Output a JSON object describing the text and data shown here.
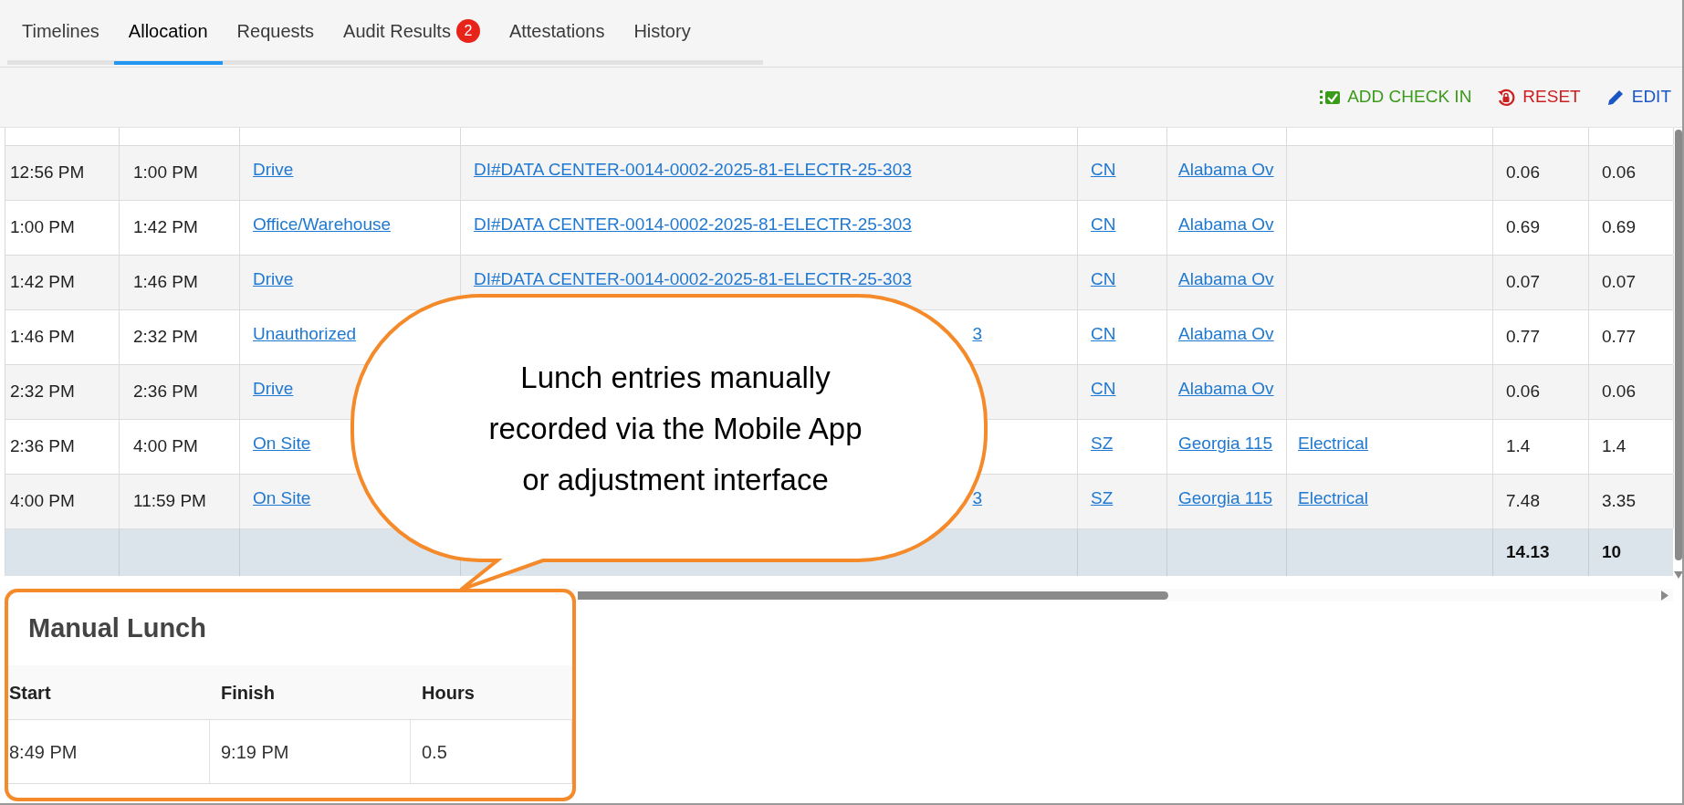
{
  "tabs": [
    {
      "label": "Timelines",
      "selected": false
    },
    {
      "label": "Allocation",
      "selected": true
    },
    {
      "label": "Requests",
      "selected": false
    },
    {
      "label": "Audit Results",
      "selected": false,
      "badge": "2"
    },
    {
      "label": "Attestations",
      "selected": false
    },
    {
      "label": "History",
      "selected": false
    }
  ],
  "toolbar": {
    "actions": [
      {
        "label": "ADD CHECK IN",
        "kind": "add"
      },
      {
        "label": "RESET",
        "kind": "reset"
      },
      {
        "label": "EDIT",
        "kind": "edit"
      }
    ]
  },
  "table": {
    "rows": [
      {
        "start": "12:56 PM",
        "finish": "1:00 PM",
        "activity": "Drive",
        "job": "DI#DATA CENTER-0014-0002-2025-81-ELECTR-25-303",
        "crew": "CN",
        "site": "Alabama Ov",
        "hours": "0.06",
        "hours_2": "0.06"
      },
      {
        "start": "1:00 PM",
        "finish": "1:42 PM",
        "activity": "Office/Warehouse",
        "job": "DI#DATA CENTER-0014-0002-2025-81-ELECTR-25-303",
        "crew": "CN",
        "site": "Alabama Ov",
        "hours": "0.69",
        "hours_2": "0.69"
      },
      {
        "start": "1:42 PM",
        "finish": "1:46 PM",
        "activity": "Drive",
        "job": "DI#DATA CENTER-0014-0002-2025-81-ELECTR-25-303",
        "crew": "CN",
        "site": "Alabama Ov",
        "hours": "0.07",
        "hours_2": "0.07"
      },
      {
        "start": "1:46 PM",
        "finish": "2:32 PM",
        "activity": "Unauthorized",
        "job_tail": "3",
        "crew": "CN",
        "site": "Alabama Ov",
        "hours": "0.77",
        "hours_2": "0.77"
      },
      {
        "start": "2:32 PM",
        "finish": "2:36 PM",
        "activity": "Drive",
        "crew": "CN",
        "site": "Alabama Ov",
        "hours": "0.06",
        "hours_2": "0.06"
      },
      {
        "start": "2:36 PM",
        "finish": "4:00 PM",
        "activity": "On Site",
        "crew": "SZ",
        "site": "Georgia 115",
        "trade": "Electrical",
        "hours": "1.4",
        "hours_2": "1.4"
      },
      {
        "start": "4:00 PM",
        "finish": "11:59 PM",
        "activity": "On Site",
        "job_tail": "3",
        "crew": "SZ",
        "site": "Georgia 115",
        "trade": "Electrical",
        "hours": "7.48",
        "hours_2": "3.35"
      }
    ],
    "totals": {
      "hours": "14.13",
      "hours_2": "10"
    }
  },
  "callout": {
    "text": "Lunch entries manually\nrecorded via the Mobile App\nor adjustment interface"
  },
  "manual_lunch": {
    "title": "Manual Lunch",
    "columns": [
      "Start",
      "Finish",
      "Hours"
    ],
    "rows": [
      [
        "8:49 PM",
        "9:19 PM",
        "0.5"
      ]
    ]
  }
}
